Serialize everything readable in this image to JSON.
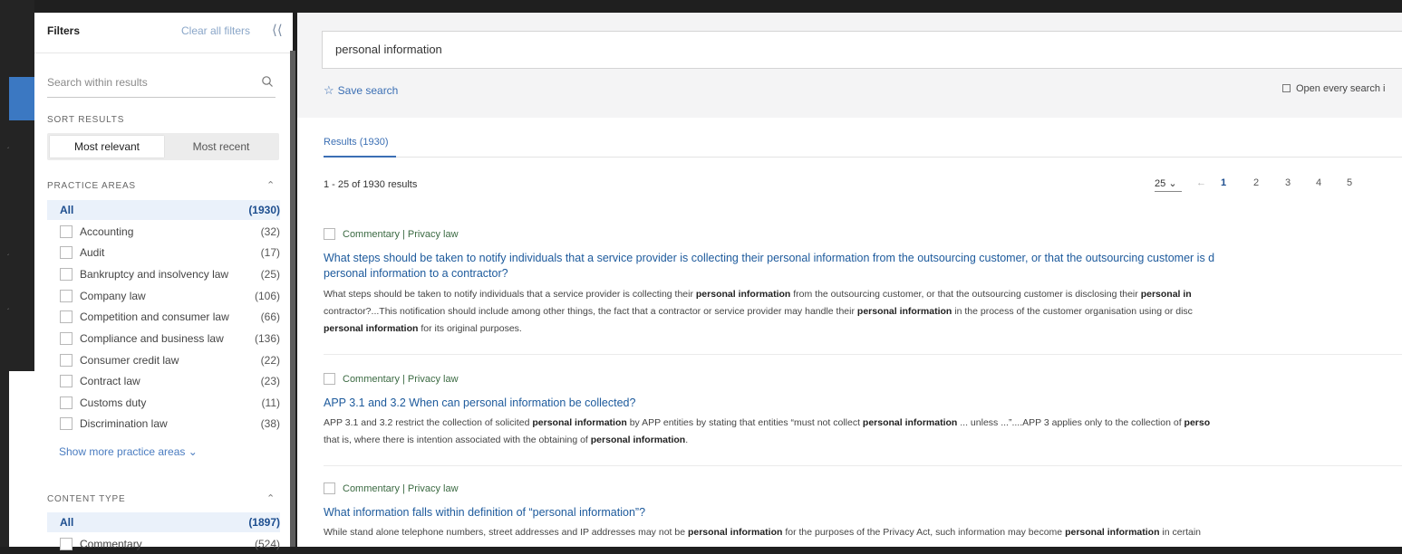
{
  "sidebar": {
    "title": "Filters",
    "clear_all": "Clear all filters",
    "search_placeholder": "Search within results",
    "sort_label": "SORT RESULTS",
    "sort_options": [
      "Most relevant",
      "Most recent"
    ],
    "practice_areas": {
      "label": "PRACTICE AREAS",
      "all_label": "All",
      "all_count": "(1930)",
      "items": [
        {
          "label": "Accounting",
          "count": "(32)"
        },
        {
          "label": "Audit",
          "count": "(17)"
        },
        {
          "label": "Bankruptcy and insolvency law",
          "count": "(25)"
        },
        {
          "label": "Company law",
          "count": "(106)"
        },
        {
          "label": "Competition and consumer law",
          "count": "(66)"
        },
        {
          "label": "Compliance and business law",
          "count": "(136)"
        },
        {
          "label": "Consumer credit law",
          "count": "(22)"
        },
        {
          "label": "Contract law",
          "count": "(23)"
        },
        {
          "label": "Customs duty",
          "count": "(11)"
        },
        {
          "label": "Discrimination law",
          "count": "(38)"
        }
      ],
      "show_more": "Show more practice areas"
    },
    "content_type": {
      "label": "CONTENT TYPE",
      "all_label": "All",
      "all_count": "(1897)",
      "items": [
        {
          "label": "Commentary",
          "count": "(524)"
        }
      ]
    }
  },
  "main": {
    "query": "personal information",
    "save_search": "Save search",
    "open_every": "Open every search i",
    "tab_results": "Results (1930)",
    "result_count": "1 - 25 of 1930 results",
    "per_page": "25",
    "pages": [
      "1",
      "2",
      "3",
      "4",
      "5"
    ],
    "results": [
      {
        "meta": "Commentary | Privacy law",
        "title": "What steps should be taken to notify individuals that a service provider is collecting their personal information from the outsourcing customer, or that the outsourcing customer is d",
        "title2": "personal information to a contractor?",
        "snippet": [
          [
            "What steps should be taken to notify individuals that a service provider is collecting their ",
            "personal information",
            " from the outsourcing customer, or that the outsourcing customer is disclosing their ",
            "personal in",
            ""
          ],
          [
            "contractor?...This notification should include among other things, the fact that a contractor or service provider may handle their ",
            "personal information",
            " in the process of the customer organisation using or disc",
            "",
            ""
          ],
          [
            "",
            "personal information",
            " for its original purposes.",
            "",
            ""
          ]
        ]
      },
      {
        "meta": "Commentary | Privacy law",
        "title": "APP 3.1 and 3.2 When can personal information be collected?",
        "snippet": [
          [
            "APP 3.1 and 3.2 restrict the collection of solicited ",
            "personal information",
            " by APP entities by stating that entities “must not collect ",
            "personal information",
            " ... unless ...”....APP 3 applies only to the collection of ",
            "perso"
          ],
          [
            "that is, where there is intention associated with the obtaining of ",
            "personal information",
            ".",
            "",
            "",
            ""
          ]
        ]
      },
      {
        "meta": "Commentary | Privacy law",
        "title": "What information falls within definition of “personal information”?",
        "snippet": [
          [
            "While stand alone telephone numbers, street addresses and IP addresses may not be ",
            "personal information",
            " for the purposes of the Privacy Act, such information may become ",
            "personal information",
            " in certain",
            ""
          ]
        ]
      }
    ]
  }
}
